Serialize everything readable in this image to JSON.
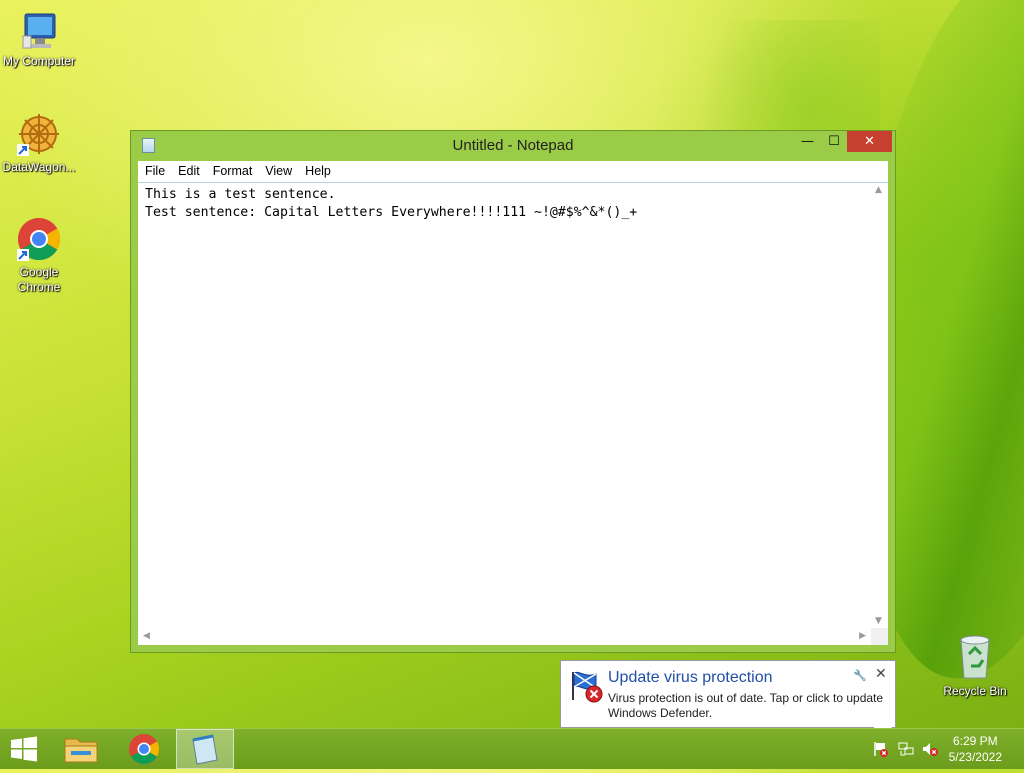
{
  "desktop": {
    "icons": [
      {
        "label": "My Computer",
        "icon": "computer-icon"
      },
      {
        "label": "DataWagon...",
        "icon": "datawagon-icon"
      },
      {
        "label": "Google Chrome",
        "icon": "chrome-icon"
      }
    ],
    "recycle_bin": {
      "label": "Recycle Bin",
      "icon": "recycle-bin-icon"
    }
  },
  "notepad": {
    "title": "Untitled - Notepad",
    "controls": {
      "minimize": "—",
      "maximize": "☐",
      "close": "✕"
    },
    "menu": [
      "File",
      "Edit",
      "Format",
      "View",
      "Help"
    ],
    "content": "This is a test sentence.\nTest sentence: Capital Letters Everywhere!!!!111 ~!@#$%^&*()_+"
  },
  "notification": {
    "title": "Update virus protection",
    "body": "Virus protection is out of date. Tap or click to update Windows Defender.",
    "icon": "defender-flag-error-icon",
    "pin": "pin-icon",
    "close": "✕"
  },
  "taskbar": {
    "items": [
      "start-button",
      "file-explorer",
      "google-chrome",
      "notepad"
    ],
    "active": "notepad",
    "clock": {
      "time": "6:29 PM",
      "date": "5/23/2022"
    },
    "tray": [
      "action-center-flag-icon",
      "network-icon",
      "volume-muted-icon"
    ]
  },
  "colors": {
    "accent": "#9bcc47",
    "close": "#c7402f",
    "toast_title": "#1f50a6"
  }
}
